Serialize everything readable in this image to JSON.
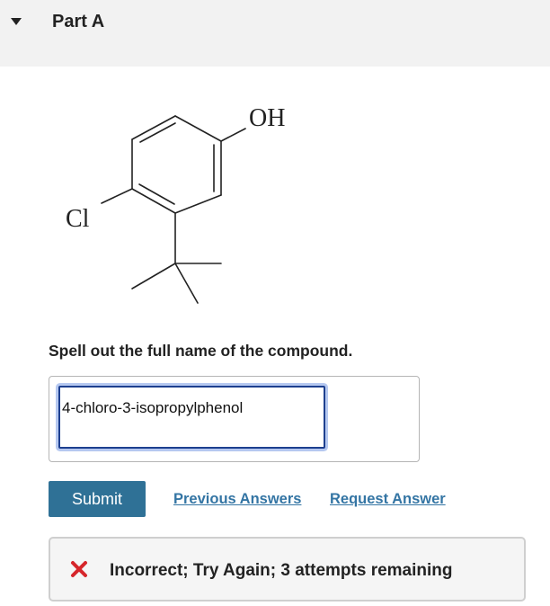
{
  "header": {
    "part_title": "Part A"
  },
  "structure": {
    "substituent_top": "OH",
    "substituent_left": "Cl"
  },
  "question": {
    "prompt": "Spell out the full name of the compound."
  },
  "answer": {
    "value": "4-chloro-3-isopropylphenol"
  },
  "actions": {
    "submit_label": "Submit",
    "previous_answers_label": "Previous Answers",
    "request_answer_label": "Request Answer"
  },
  "feedback": {
    "message": "Incorrect; Try Again; 3 attempts remaining",
    "status_color": "#d6262b"
  },
  "icons": {
    "collapse": "caret-down-icon",
    "status": "incorrect-x-icon"
  }
}
